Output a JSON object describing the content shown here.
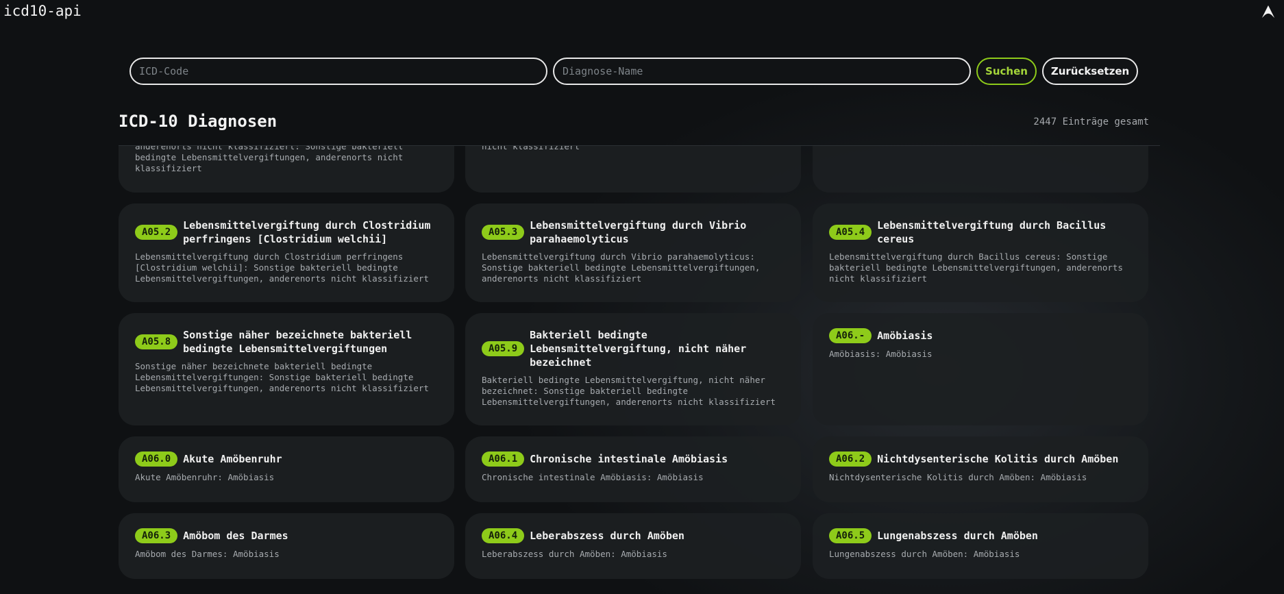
{
  "header": {
    "app_title": "icd10-api",
    "logo_icon": "arch-logo-icon"
  },
  "search": {
    "code_placeholder": "ICD-Code",
    "name_placeholder": "Diagnose-Name",
    "search_label": "Suchen",
    "reset_label": "Zurücksetzen"
  },
  "section": {
    "title": "ICD-10 Diagnosen",
    "count": "2447 Einträge gesamt"
  },
  "colors": {
    "accent": "#8ecb1a",
    "background": "#111315",
    "card": "#1c1f22"
  },
  "partial_cards": {
    "a_desc": "anderenorts nicht klassifiziert: Sonstige bakteriell bedingte Lebensmittelvergiftungen, anderenorts nicht klassifiziert",
    "b_desc": "nicht klassifiziert"
  },
  "cards": [
    {
      "code": "A05.2",
      "title": "Lebensmittelvergiftung durch Clostridium perfringens [Clostridium welchii]",
      "desc": "Lebensmittelvergiftung durch Clostridium perfringens [Clostridium welchii]: Sonstige bakteriell bedingte Lebensmittelvergiftungen, anderenorts nicht klassifiziert"
    },
    {
      "code": "A05.3",
      "title": "Lebensmittelvergiftung durch Vibrio parahaemolyticus",
      "desc": "Lebensmittelvergiftung durch Vibrio parahaemolyticus: Sonstige bakteriell bedingte Lebensmittelvergiftungen, anderenorts nicht klassifiziert"
    },
    {
      "code": "A05.4",
      "title": "Lebensmittelvergiftung durch Bacillus cereus",
      "desc": "Lebensmittelvergiftung durch Bacillus cereus: Sonstige bakteriell bedingte Lebensmittelvergiftungen, anderenorts nicht klassifiziert"
    },
    {
      "code": "A05.8",
      "title": "Sonstige näher bezeichnete bakteriell bedingte Lebensmittelvergiftungen",
      "desc": "Sonstige näher bezeichnete bakteriell bedingte Lebensmittelvergiftungen: Sonstige bakteriell bedingte Lebensmittelvergiftungen, anderenorts nicht klassifiziert"
    },
    {
      "code": "A05.9",
      "title": "Bakteriell bedingte Lebensmittelvergiftung, nicht näher bezeichnet",
      "desc": "Bakteriell bedingte Lebensmittelvergiftung, nicht näher bezeichnet: Sonstige bakteriell bedingte Lebensmittelvergiftungen, anderenorts nicht klassifiziert"
    },
    {
      "code": "A06.-",
      "title": "Amöbiasis",
      "desc": "Amöbiasis: Amöbiasis"
    },
    {
      "code": "A06.0",
      "title": "Akute Amöbenruhr",
      "desc": "Akute Amöbenruhr: Amöbiasis"
    },
    {
      "code": "A06.1",
      "title": "Chronische intestinale Amöbiasis",
      "desc": "Chronische intestinale Amöbiasis: Amöbiasis"
    },
    {
      "code": "A06.2",
      "title": "Nichtdysenterische Kolitis durch Amöben",
      "desc": "Nichtdysenterische Kolitis durch Amöben: Amöbiasis"
    },
    {
      "code": "A06.3",
      "title": "Amöbom des Darmes",
      "desc": "Amöbom des Darmes: Amöbiasis"
    },
    {
      "code": "A06.4",
      "title": "Leberabszess durch Amöben",
      "desc": "Leberabszess durch Amöben: Amöbiasis"
    },
    {
      "code": "A06.5",
      "title": "Lungenabszess durch Amöben",
      "desc": "Lungenabszess durch Amöben: Amöbiasis"
    }
  ]
}
